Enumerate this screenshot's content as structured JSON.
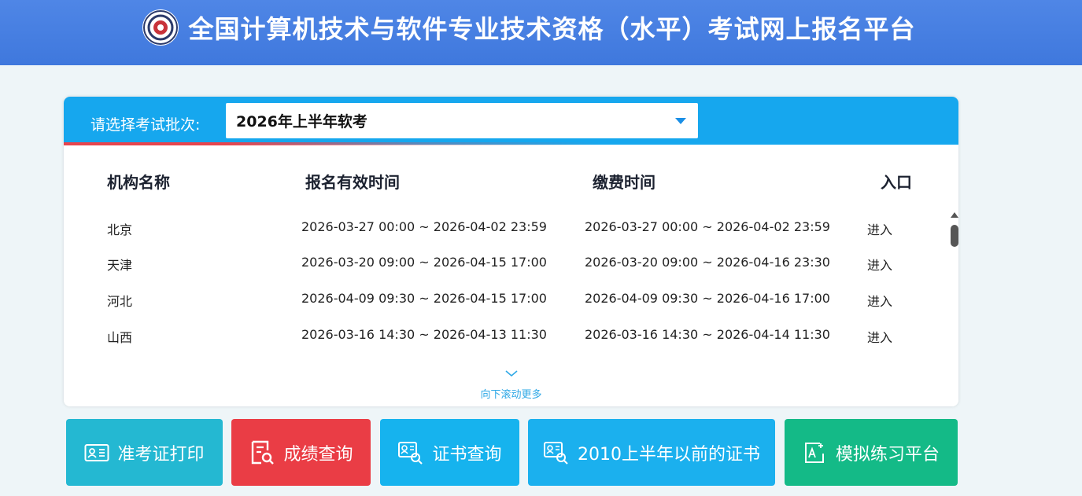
{
  "header": {
    "title": "全国计算机技术与软件专业技术资格（水平）考试网上报名平台",
    "logo_icon": "exam-emblem-icon"
  },
  "batch": {
    "label": "请选择考试批次:",
    "selected": "2026年上半年软考"
  },
  "table": {
    "columns": [
      "机构名称",
      "报名有效时间",
      "缴费时间",
      "入口"
    ],
    "rows": [
      {
        "name": "北京",
        "reg": "2026-03-27 00:00 ~ 2026-04-02 23:59",
        "pay": "2026-03-27 00:00 ~ 2026-04-02 23:59",
        "entry": "进入"
      },
      {
        "name": "天津",
        "reg": "2026-03-20 09:00 ~ 2026-04-15 17:00",
        "pay": "2026-03-20 09:00 ~ 2026-04-16 23:30",
        "entry": "进入"
      },
      {
        "name": "河北",
        "reg": "2026-04-09 09:30 ~ 2026-04-15 17:00",
        "pay": "2026-04-09 09:30 ~ 2026-04-16 17:00",
        "entry": "进入"
      },
      {
        "name": "山西",
        "reg": "2026-03-16 14:30 ~ 2026-04-13 11:30",
        "pay": "2026-03-16 14:30 ~ 2026-04-14 11:30",
        "entry": "进入"
      }
    ],
    "scroll_more": "向下滚动更多"
  },
  "buttons": {
    "ticket": "准考证打印",
    "score": "成绩查询",
    "cert": "证书查询",
    "old_cert": "2010上半年以前的证书",
    "sim": "模拟练习平台"
  },
  "colors": {
    "header": "#4f86e6",
    "panel_head": "#16a7ee",
    "ticket": "#24b8d2",
    "score": "#ea3d45",
    "cert": "#16b3ee",
    "sim": "#14ba87"
  }
}
